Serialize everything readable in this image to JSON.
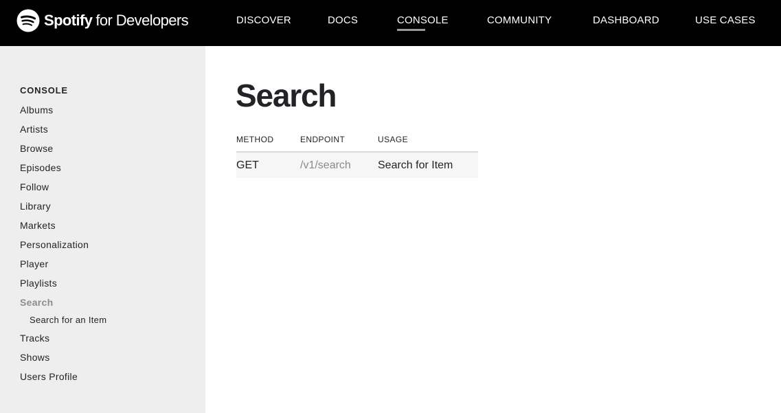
{
  "header": {
    "brand_name": "Spotify",
    "brand_sub": "for Developers",
    "nav": {
      "discover": "DISCOVER",
      "docs": "DOCS",
      "console": "CONSOLE",
      "community": "COMMUNITY",
      "dashboard": "DASHBOARD",
      "use_cases": "USE CASES"
    },
    "active_nav": "CONSOLE"
  },
  "sidebar": {
    "heading": "CONSOLE",
    "items": [
      "Albums",
      "Artists",
      "Browse",
      "Episodes",
      "Follow",
      "Library",
      "Markets",
      "Personalization",
      "Player",
      "Playlists",
      "Search",
      "Tracks",
      "Shows",
      "Users Profile"
    ],
    "active_item": "Search",
    "sub_item": "Search for an Item"
  },
  "main": {
    "title": "Search",
    "table": {
      "headers": [
        "METHOD",
        "ENDPOINT",
        "USAGE"
      ],
      "rows": [
        {
          "method": "GET",
          "endpoint": "/v1/search",
          "usage": "Search for Item"
        }
      ]
    }
  },
  "colors": {
    "topbar": "#000000",
    "sidebar_bg": "#eeeeee",
    "active_sidebar_text": "#8d8d8d",
    "endpoint_text": "#8a8a8a",
    "text": "#222326"
  },
  "icons": [
    "spotify-logo-icon"
  ]
}
